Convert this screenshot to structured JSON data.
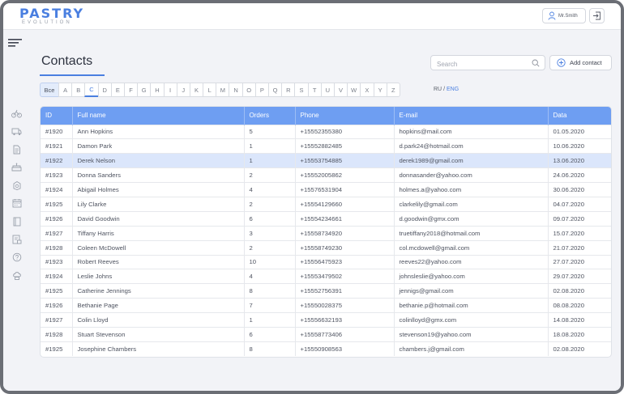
{
  "app": {
    "logo_main": "PASTRY",
    "logo_sub": "EVOLUTION",
    "user_name": "Mr.Smith"
  },
  "page": {
    "title": "Contacts",
    "search_placeholder": "Search",
    "add_contact_label": "Add contact"
  },
  "filter": {
    "all_label": "Все",
    "letters": [
      "A",
      "B",
      "C",
      "D",
      "E",
      "F",
      "G",
      "H",
      "I",
      "J",
      "K",
      "L",
      "M",
      "N",
      "O",
      "P",
      "Q",
      "R",
      "S",
      "T",
      "U",
      "V",
      "W",
      "X",
      "Y",
      "Z"
    ],
    "active_letter": "C",
    "lang_ru": "RU",
    "lang_sep": " / ",
    "lang_eng": "ENG"
  },
  "table": {
    "headers": [
      "ID",
      "Full name",
      "Orders",
      "Phone",
      "E-mail",
      "Data"
    ],
    "selected_row": 2,
    "rows": [
      [
        "#1920",
        "Ann Hopkins",
        "5",
        "+15552355380",
        "hopkins@mail.com",
        "01.05.2020"
      ],
      [
        "#1921",
        "Damon Park",
        "1",
        "+15552882485",
        "d.park24@hotmail.com",
        "10.06.2020"
      ],
      [
        "#1922",
        "Derek Nelson",
        "1",
        "+15553754885",
        "derek1989@gmail.com",
        "13.06.2020"
      ],
      [
        "#1923",
        "Donna Sanders",
        "2",
        "+15552005862",
        "donnasander@yahoo.com",
        "24.06.2020"
      ],
      [
        "#1924",
        "Abigail Holmes",
        "4",
        "+15576531904",
        "holmes.a@yahoo.com",
        "30.06.2020"
      ],
      [
        "#1925",
        "Lily Clarke",
        "2",
        "+15554129660",
        "clarkelily@gmail.com",
        "04.07.2020"
      ],
      [
        "#1926",
        "David Goodwin",
        "6",
        "+15554234661",
        "d.goodwin@gmx.com",
        "09.07.2020"
      ],
      [
        "#1927",
        "Tiffany Harris",
        "3",
        "+15558734920",
        "truetiffany2018@hotmail.com",
        "15.07.2020"
      ],
      [
        "#1928",
        "Coleen McDowell",
        "2",
        "+15558749230",
        "col.mcdowell@gmail.com",
        "21.07.2020"
      ],
      [
        "#1923",
        "Robert Reeves",
        "10",
        "+15556475923",
        "reeves22@yahoo.com",
        "27.07.2020"
      ],
      [
        "#1924",
        "Leslie Johns",
        "4",
        "+15553479502",
        "johnsleslie@yahoo.com",
        "29.07.2020"
      ],
      [
        "#1925",
        "Catherine Jennings",
        "8",
        "+15552756391",
        "jennigs@gmail.com",
        "02.08.2020"
      ],
      [
        "#1926",
        "Bethanie Page",
        "7",
        "+15550028375",
        "bethanie.p@hotmail.com",
        "08.08.2020"
      ],
      [
        "#1927",
        "Colin Lloyd",
        "1",
        "+15556632193",
        "colinlloyd@gmx.com",
        "14.08.2020"
      ],
      [
        "#1928",
        "Stuart Stevenson",
        "6",
        "+15558773406",
        "stevenson19@yahoo.com",
        "18.08.2020"
      ],
      [
        "#1925",
        "Josephine Chambers",
        "8",
        "+15550908563",
        "chambers.j@gmail.com",
        "02.08.2020"
      ]
    ]
  },
  "sidebar": {
    "icons": [
      "bicycle-icon",
      "truck-icon",
      "document-icon",
      "cake-icon",
      "cake-box-icon",
      "calendar-icon",
      "book-icon",
      "contacts-icon",
      "help-icon",
      "chef-icon"
    ]
  },
  "colors": {
    "accent": "#4a7fe0",
    "header_bg": "#6e9ef2",
    "selected_row": "#dbe6fb"
  }
}
